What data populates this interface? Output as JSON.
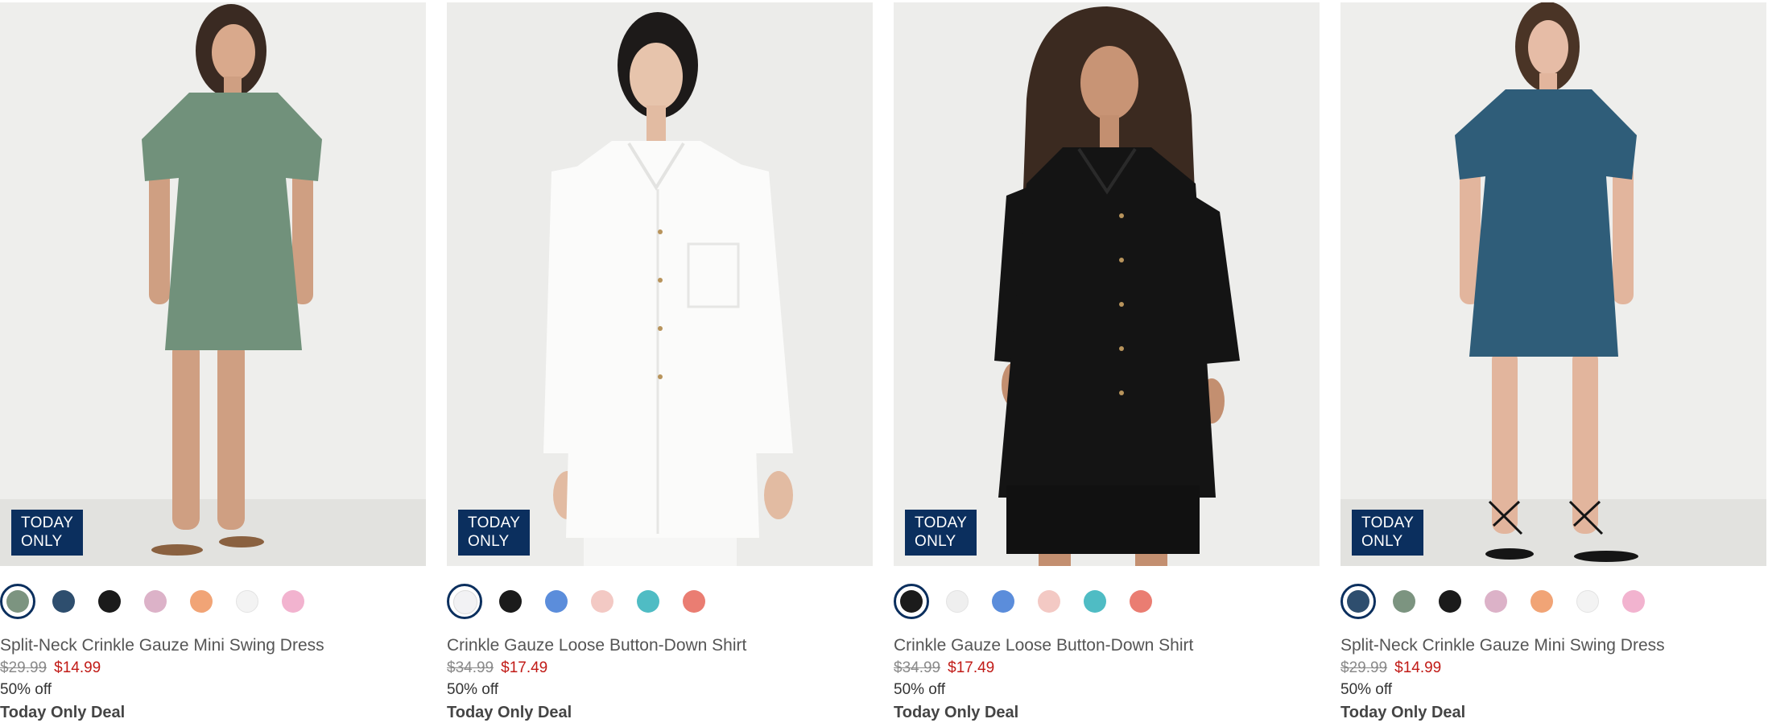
{
  "products": [
    {
      "name": "Split-Neck Crinkle Gauze Mini Swing Dress",
      "was_price": "$29.99",
      "sale_price": "$14.99",
      "discount": "50% off",
      "deal_label": "Today Only Deal",
      "badge": "TODAY\nONLY",
      "garment_color": "#71917b",
      "backdrop_color": "#eeeeec",
      "swatches": [
        "#7c9480",
        "#2e4e6e",
        "#1b1b1b",
        "#dcb2c8",
        "#f1a476",
        "#f3f3f3",
        "#f2b3cf"
      ],
      "selected_swatch": 0
    },
    {
      "name": "Crinkle Gauze Loose Button-Down Shirt",
      "was_price": "$34.99",
      "sale_price": "$17.49",
      "discount": "50% off",
      "deal_label": "Today Only Deal",
      "badge": "TODAY\nONLY",
      "garment_color": "#fbfbfa",
      "backdrop_color": "#ececea",
      "swatches": [
        "#f2f2f4",
        "#1b1b1b",
        "#5b8ddb",
        "#f3c9c4",
        "#4fbcc4",
        "#ea7d72"
      ],
      "selected_swatch": 0
    },
    {
      "name": "Crinkle Gauze Loose Button-Down Shirt",
      "was_price": "$34.99",
      "sale_price": "$17.49",
      "discount": "50% off",
      "deal_label": "Today Only Deal",
      "badge": "TODAY\nONLY",
      "garment_color": "#141414",
      "backdrop_color": "#ededeb",
      "swatches": [
        "#1b1b1b",
        "#efefef",
        "#5b8ddb",
        "#f3c9c4",
        "#4fbcc4",
        "#ea7d72"
      ],
      "selected_swatch": 0
    },
    {
      "name": "Split-Neck Crinkle Gauze Mini Swing Dress",
      "was_price": "$29.99",
      "sale_price": "$14.99",
      "discount": "50% off",
      "deal_label": "Today Only Deal",
      "badge": "TODAY\nONLY",
      "garment_color": "#2f5d79",
      "backdrop_color": "#eeeeec",
      "swatches": [
        "#2e4e6e",
        "#7c9480",
        "#1b1b1b",
        "#dcb2c8",
        "#f1a476",
        "#f3f3f3",
        "#f2b3cf"
      ],
      "selected_swatch": 0
    }
  ]
}
